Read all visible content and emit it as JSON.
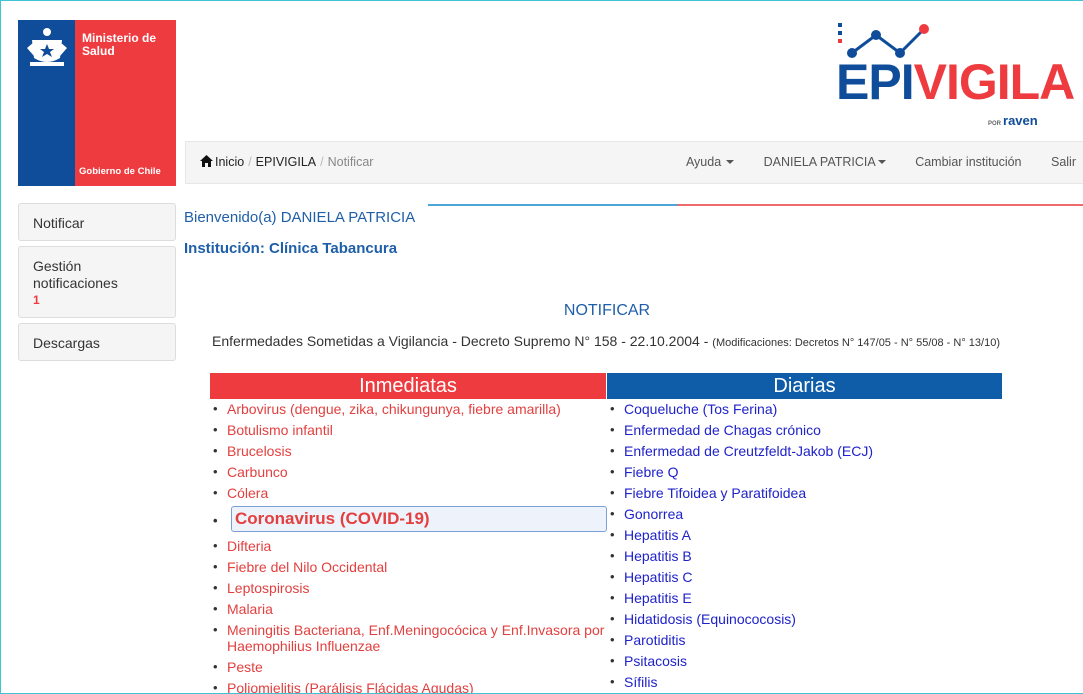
{
  "logo": {
    "ministerio": "Ministerio de Salud",
    "gobierno": "Gobierno de Chile"
  },
  "brand": {
    "epi": "EPI",
    "vigila": "VIGILA",
    "por": "POR",
    "raven": "raven"
  },
  "breadcrumb": {
    "home": "Inicio",
    "section": "EPIVIGILA",
    "current": "Notificar"
  },
  "nav": {
    "ayuda": "Ayuda",
    "user": "DANIELA PATRICIA",
    "cambiar": "Cambiar institución",
    "salir": "Salir"
  },
  "sidebar": {
    "notificar": "Notificar",
    "gestion": "Gestión notificaciones",
    "gestion_count": "1",
    "descargas": "Descargas"
  },
  "main": {
    "welcome": "Bienvenido(a) DANIELA PATRICIA",
    "institucion": "Institución: Clínica Tabancura",
    "title": "NOTIFICAR",
    "decreto": "Enfermedades Sometidas a Vigilancia - Decreto Supremo N° 158 - 22.10.2004 -",
    "modificaciones": "(Modificaciones: Decretos N° 147/05 - N° 55/08 - N° 13/10)"
  },
  "inmediatas": {
    "header": "Inmediatas",
    "items": [
      "Arbovirus (dengue, zika, chikungunya, fiebre amarilla)",
      "Botulismo infantil",
      "Brucelosis",
      "Carbunco",
      "Cólera",
      "Coronavirus (COVID-19)",
      "Difteria",
      "Fiebre del Nilo Occidental",
      "Leptospirosis",
      "Malaria",
      "Meningitis Bacteriana, Enf.Meningocócica y Enf.Invasora por Haemophilius Influenzae",
      "Peste",
      "Poliomielitis (Parálisis Flácidas Agudas)"
    ]
  },
  "diarias": {
    "header": "Diarias",
    "items": [
      "Coqueluche (Tos Ferina)",
      "Enfermedad de Chagas crónico",
      "Enfermedad de Creutzfeldt-Jakob (ECJ)",
      "Fiebre Q",
      "Fiebre Tifoidea y Paratifoidea",
      "Gonorrea",
      "Hepatitis A",
      "Hepatitis B",
      "Hepatitis C",
      "Hepatitis E",
      "Hidatidosis (Equinococosis)",
      "Parotiditis",
      "Psitacosis",
      "Sífilis"
    ]
  }
}
